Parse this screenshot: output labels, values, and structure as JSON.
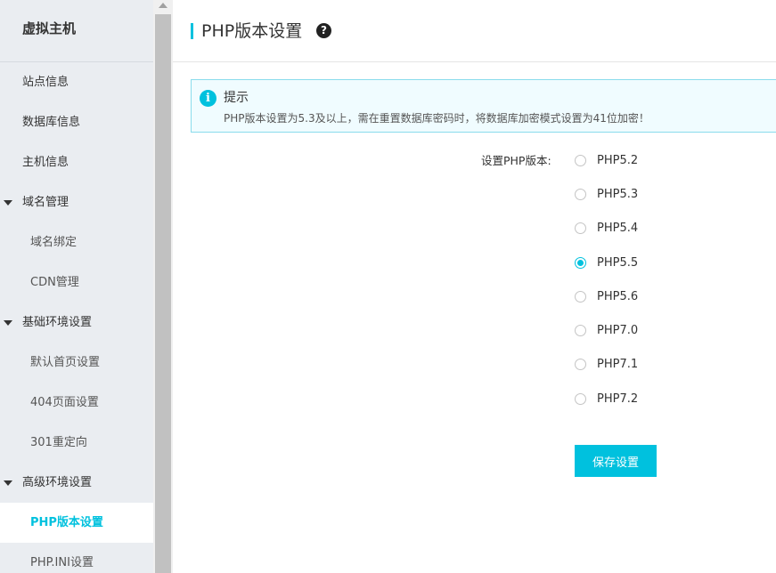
{
  "sidebar": {
    "title": "虚拟主机",
    "items": [
      {
        "label": "站点信息"
      },
      {
        "label": "数据库信息"
      },
      {
        "label": "主机信息"
      },
      {
        "label": "域名管理"
      },
      {
        "label": "域名绑定"
      },
      {
        "label": "CDN管理"
      },
      {
        "label": "基础环境设置"
      },
      {
        "label": "默认首页设置"
      },
      {
        "label": "404页面设置"
      },
      {
        "label": "301重定向"
      },
      {
        "label": "高级环境设置"
      },
      {
        "label": "PHP版本设置"
      },
      {
        "label": "PHP.INI设置"
      }
    ]
  },
  "header": {
    "title": "PHP版本设置",
    "help_glyph": "?"
  },
  "notice": {
    "icon_glyph": "i",
    "title": "提示",
    "text": "PHP版本设置为5.3及以上，需在重置数据库密码时，将数据库加密模式设置为41位加密！"
  },
  "form": {
    "label": "设置PHP版本:",
    "options": [
      {
        "label": "PHP5.2"
      },
      {
        "label": "PHP5.3"
      },
      {
        "label": "PHP5.4"
      },
      {
        "label": "PHP5.5"
      },
      {
        "label": "PHP5.6"
      },
      {
        "label": "PHP7.0"
      },
      {
        "label": "PHP7.1"
      },
      {
        "label": "PHP7.2"
      }
    ],
    "selected": "PHP5.5",
    "save_label": "保存设置"
  },
  "colors": {
    "accent": "#00c1de",
    "sidebar_bg": "#eaedf1",
    "notice_bg": "#f0fcff"
  }
}
